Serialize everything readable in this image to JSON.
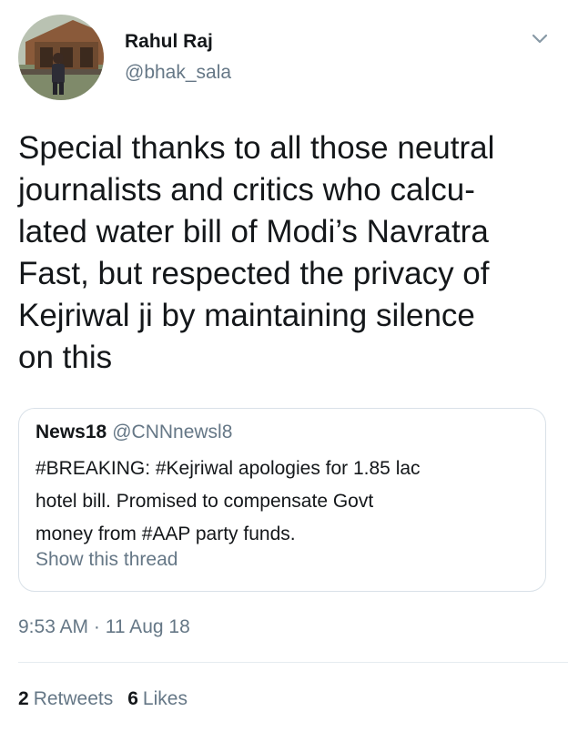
{
  "author": {
    "display_name": "Rahul Raj",
    "handle": "@bhak_sala"
  },
  "tweet": {
    "lines": [
      "Special thanks to all those neutral",
      "journalists and critics who calcu-",
      "lated water bill of Modi’s Navratra",
      "Fast, but  respected the privacy of",
      "Kejriwal ji by maintaining silence",
      "on this"
    ]
  },
  "quoted": {
    "name": "News18",
    "handle": "@CNNnewsl8",
    "lines": [
      "#BREAKING:  #Kejriwal apologies for 1.85 lac",
      "hotel bill. Promised to compensate Govt",
      "money from #AAP party funds."
    ],
    "show_thread": "Show this thread"
  },
  "meta": {
    "timestamp": "9:53 AM · 11 Aug 18"
  },
  "stats": {
    "retweets_count": "2",
    "retweets_label": "Retweets",
    "likes_count": "6",
    "likes_label": "Likes"
  },
  "colors": {
    "text": "#14171a",
    "secondary": "#657786",
    "border": "#d9e1e8"
  },
  "icons": {
    "more": "chevron-down-icon"
  }
}
